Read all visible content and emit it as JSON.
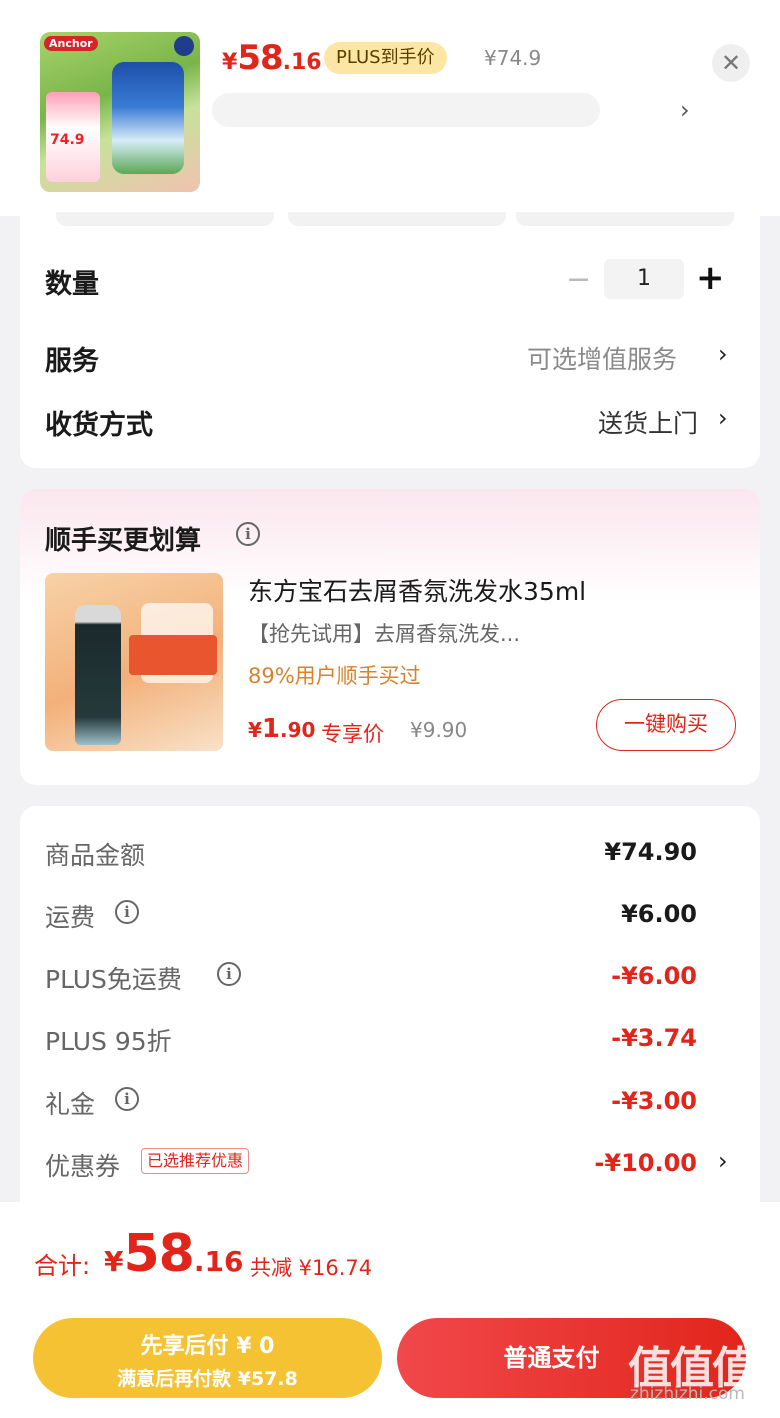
{
  "header": {
    "price_currency": "¥",
    "price_integer": "58",
    "price_decimal": ".16",
    "plus_badge": "PLUS到手价",
    "original_price": "¥74.9",
    "close_icon": "✕",
    "spec_arrow": "›",
    "thumb_logo": "Anchor",
    "thumb_tag_price": "74.9"
  },
  "options": {
    "quantity_label": "数量",
    "quantity_minus": "−",
    "quantity_value": "1",
    "quantity_plus": "+",
    "service_label": "服务",
    "service_value": "可选增值服务",
    "delivery_label": "收货方式",
    "delivery_value": "送货上门",
    "chevron": "›"
  },
  "addon": {
    "title": "顺手买更划算",
    "info_icon": "i",
    "product_name": "东方宝石去屑香氛洗发水35ml",
    "subtitle": "【抢先试用】去屑香氛洗发...",
    "hot_text": "89%用户顺手买过",
    "price_currency": "¥",
    "price_integer": "1",
    "price_decimal": ".90",
    "price_tag": "专享价",
    "original_price": "¥9.90",
    "buy_button": "一键购买"
  },
  "costs": {
    "rows": [
      {
        "label": "商品金额",
        "value": "¥74.90",
        "info": false
      },
      {
        "label": "运费",
        "value": "¥6.00",
        "info": true
      },
      {
        "label": "PLUS免运费",
        "value": "-¥6.00",
        "info": true
      },
      {
        "label": "PLUS 95折",
        "value": "-¥3.74",
        "info": false
      },
      {
        "label": "礼金",
        "value": "-¥3.00",
        "info": true
      },
      {
        "label": "优惠券",
        "value": "-¥10.00",
        "info": false
      }
    ],
    "coupon_tag": "已选推荐优惠",
    "chevron": "›",
    "info_icon": "i"
  },
  "bottom": {
    "total_label": "合计:",
    "total_currency": "¥",
    "total_integer": "58",
    "total_decimal": ".16",
    "total_saved": "共减 ¥16.74",
    "pay_later_line1": "先享后付 ¥ 0",
    "pay_later_line2": "满意后再付款 ¥57.8",
    "pay_button": "普通支付",
    "watermark": "值值值",
    "watermark_url": "zhizhizhi.com"
  },
  "colors": {
    "accent_red": "#e1251b",
    "plus_gold": "#fbe7a3",
    "pay_later_yellow": "#f5c233",
    "hot_orange": "#d9822b"
  }
}
